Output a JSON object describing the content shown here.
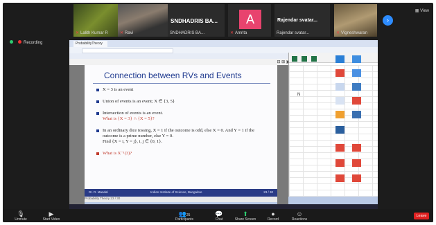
{
  "participants": [
    {
      "name": "Lalith Kumar R",
      "muted": true
    },
    {
      "name": "Ravi",
      "muted": true
    },
    {
      "name": "SNDHADRIS BA...",
      "sub": "SNDHADRIS BA...",
      "muted": false
    },
    {
      "name": "Amrita",
      "avatar_letter": "A",
      "muted": true
    },
    {
      "name": "Rajendar svatar...",
      "sub": "Rajendar svatar...",
      "muted": false
    },
    {
      "name": "Vigneshwaran",
      "muted": true
    }
  ],
  "next_page_label": "›",
  "view_label": "View",
  "recording_label": "Recording",
  "browser": {
    "tab_title": "ProbabilityTheory",
    "url": ""
  },
  "excel": {
    "cell_value": "N"
  },
  "slide": {
    "title": "Connection between RVs and Events",
    "bullets": [
      {
        "text": "X = 3 is an event",
        "red": false
      },
      {
        "text": "Union of events is an event; X ∈ {3, 5}",
        "red": false
      },
      {
        "text": "Intersection of events is an event.",
        "extra": "What is {X = 3} ∩ {X = 5}?",
        "red": false
      },
      {
        "text": "In an ordinary dice tossing, X = 1 if the outcome is odd, else X = 0. And Y = 1 if the outcome is a prime number, else Y = 0.",
        "extra": "Find {X = i, Y = j}, i, j ∈ {0, 1}.",
        "red": false
      },
      {
        "text": "What is X⁻¹(3)?",
        "red": true
      }
    ],
    "footer_left": "Dr. R. Mandal",
    "footer_center": "Indian Institute of Science, Bangalore",
    "footer_right": "23 / 30",
    "page_bar": "Probability Theory     23 / 30"
  },
  "controls": [
    {
      "label": "Unmute",
      "icon": "mic-icon"
    },
    {
      "label": "Start Video",
      "icon": "video-icon"
    },
    {
      "label": "Participants",
      "icon": "participants-icon",
      "count": "25"
    },
    {
      "label": "Chat",
      "icon": "chat-icon"
    },
    {
      "label": "Share Screen",
      "icon": "share-icon"
    },
    {
      "label": "Record",
      "icon": "record-icon"
    },
    {
      "label": "Reactions",
      "icon": "reactions-icon"
    }
  ],
  "end_label": "Leave"
}
